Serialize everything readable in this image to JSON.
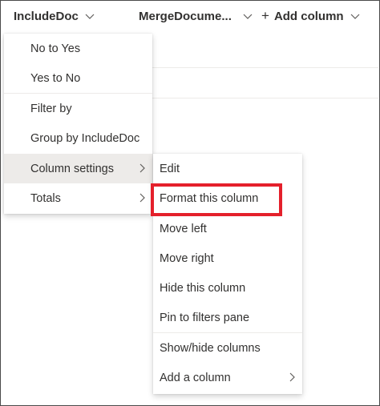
{
  "header": {
    "col1_label": "IncludeDoc",
    "col2_label": "MergeDocume...",
    "add_column_label": "Add column"
  },
  "main_menu": {
    "items": [
      {
        "label": "No to Yes"
      },
      {
        "label": "Yes to No"
      },
      {
        "label": "Filter by"
      },
      {
        "label": "Group by IncludeDoc"
      },
      {
        "label": "Column settings"
      },
      {
        "label": "Totals"
      }
    ]
  },
  "sub_menu": {
    "items": [
      {
        "label": "Edit"
      },
      {
        "label": "Format this column"
      },
      {
        "label": "Move left"
      },
      {
        "label": "Move right"
      },
      {
        "label": "Hide this column"
      },
      {
        "label": "Pin to filters pane"
      },
      {
        "label": "Show/hide columns"
      },
      {
        "label": "Add a column"
      }
    ]
  },
  "colors": {
    "highlight": "#e4202b",
    "hover_bg": "#edebe9",
    "text": "#323130"
  },
  "icons": {
    "dropdown": "chevron-down-icon",
    "submenu": "chevron-right-icon",
    "add": "plus-icon"
  }
}
